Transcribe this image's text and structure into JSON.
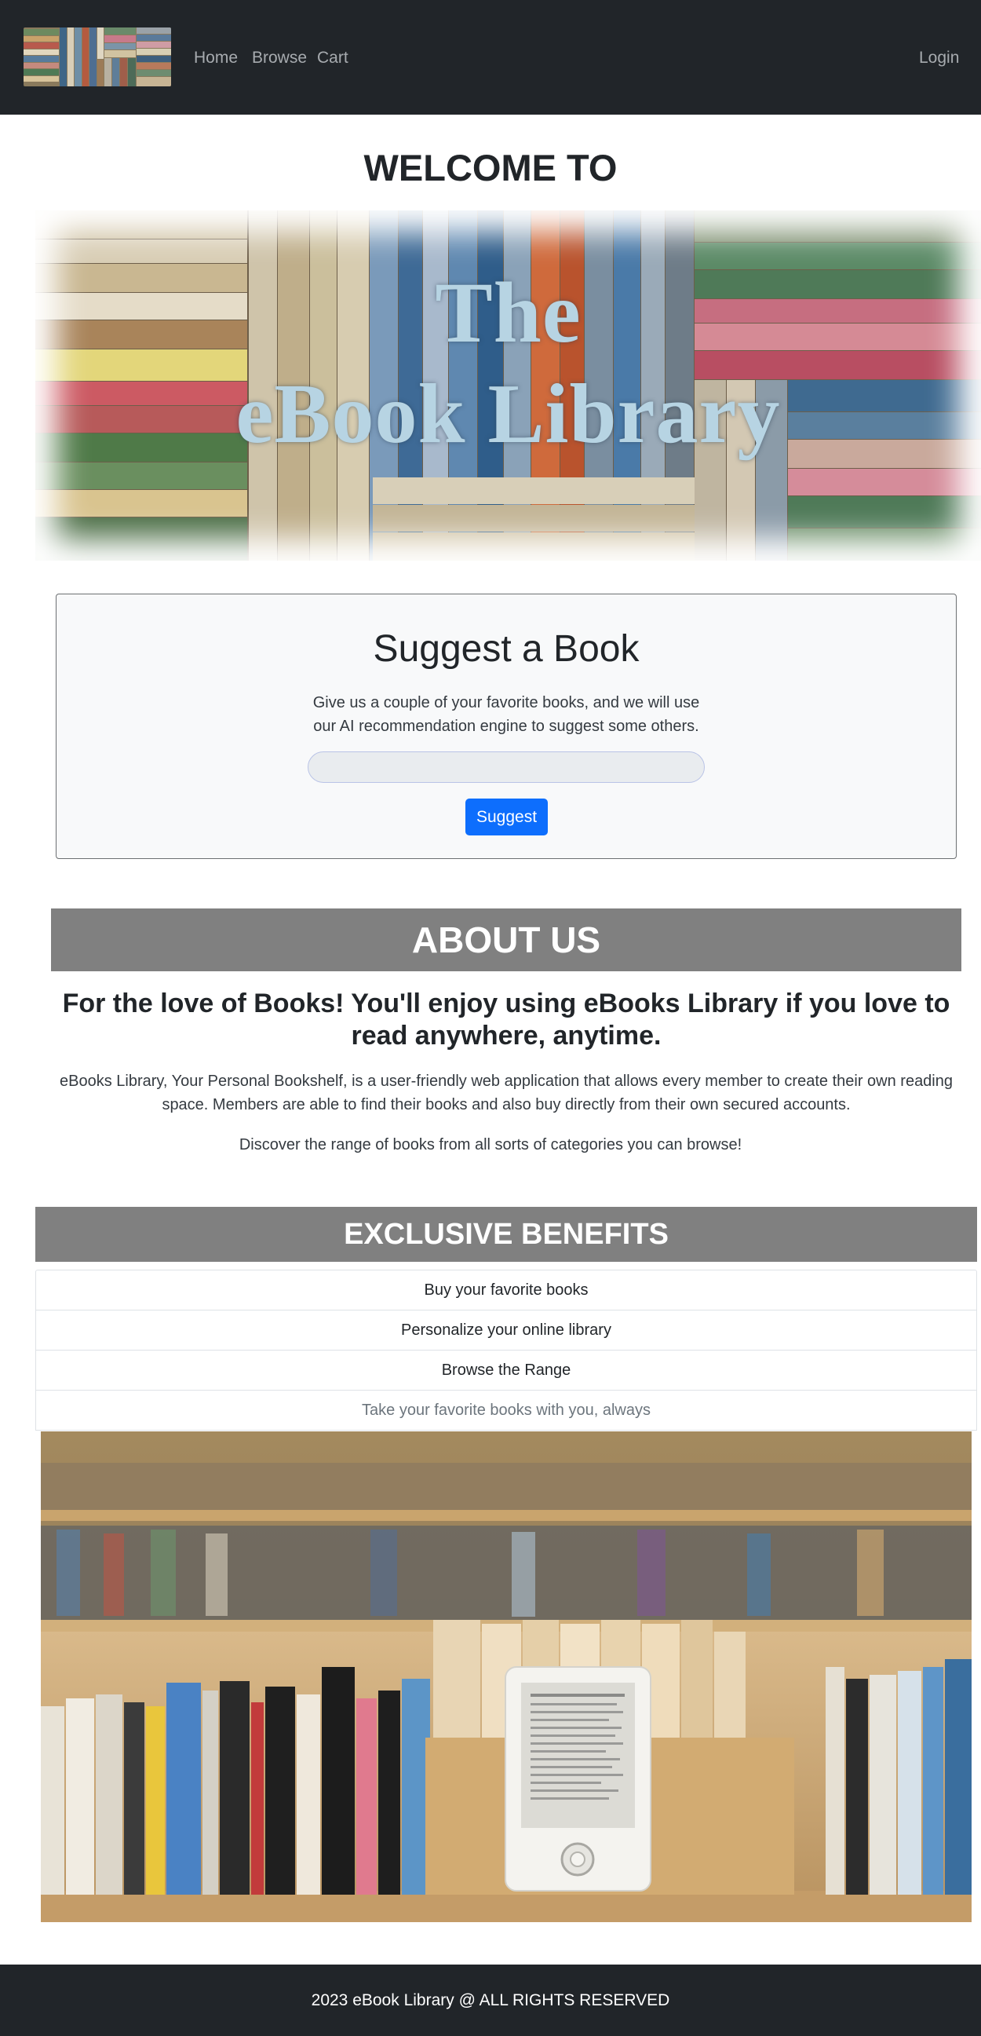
{
  "nav": {
    "links": [
      "Home",
      "Browse",
      "Cart"
    ],
    "login": "Login"
  },
  "welcome": "WELCOME TO",
  "hero": {
    "line1": "The",
    "line2": "eBook Library"
  },
  "suggest": {
    "title": "Suggest a Book",
    "description": "Give us a couple of your favorite books, and we will use our AI recommendation engine to suggest some others.",
    "input_value": "",
    "button": "Suggest"
  },
  "about": {
    "title": "ABOUT US",
    "headline": "For the love of Books! You'll enjoy using eBooks Library if you love to read anywhere, anytime.",
    "paragraph1": "eBooks Library, Your Personal Bookshelf, is a user-friendly web application that allows every member to create their own reading space. Members are able to find their books and also buy directly from their own secured accounts.",
    "paragraph2": "Discover the range of books from all sorts of categories you can browse!"
  },
  "benefits": {
    "title": "EXCLUSIVE BENEFITS",
    "items": [
      "Buy your favorite books",
      "Personalize your online library",
      "Browse the Range",
      "Take your favorite books with you, always"
    ]
  },
  "footer": "2023 eBook Library @ ALL RIGHTS RESERVED",
  "colors": {
    "navbar": "#212529",
    "nav_link": "#a7abaf",
    "band": "#808080",
    "primary_button": "#0d6efd",
    "hero_text": "#b7d4e3"
  }
}
